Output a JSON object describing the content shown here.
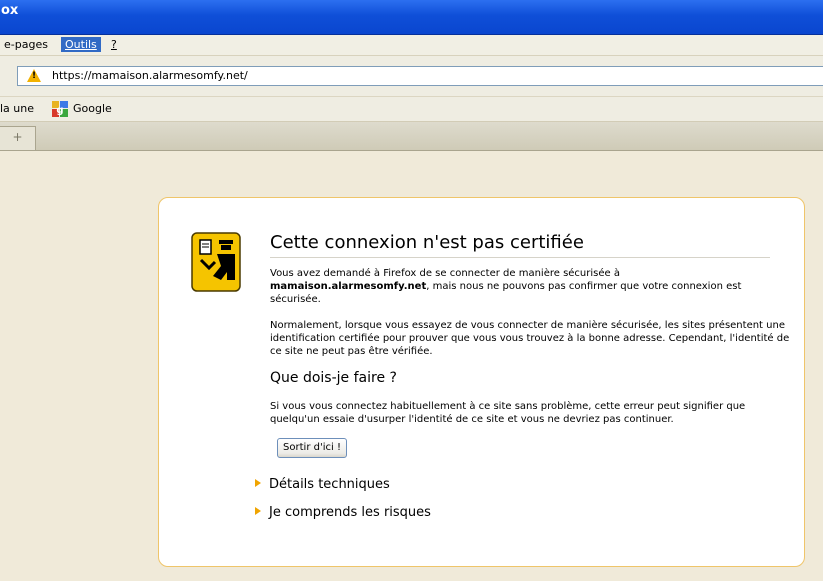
{
  "window": {
    "title": "ox"
  },
  "menubar": {
    "items": [
      {
        "label": "e-pages"
      },
      {
        "label": "Outils",
        "accelerator_char": "O"
      },
      {
        "label": "?"
      }
    ]
  },
  "navbar": {
    "url": "https://mamaison.alarmesomfy.net/"
  },
  "bookmarks": {
    "items": [
      {
        "label": "la une"
      },
      {
        "label": "Google"
      }
    ]
  },
  "tab": {
    "icon": "new-tab-icon",
    "glyph": "+"
  },
  "error_page": {
    "title": "Cette connexion n'est pas certifiée",
    "intro_prefix": "Vous avez demandé à Firefox de se connecter de manière sécurisée à",
    "intro_domain": "mamaison.alarmesomfy.net",
    "intro_suffix": ", mais nous ne pouvons pas confirmer que votre connexion est sécurisée.",
    "normal_text": "Normalement, lorsque vous essayez de vous connecter de manière sécurisée, les sites présentent une identification certifiée pour prouver que vous vous trouvez à la bonne adresse. Cependant, l'identité de ce site ne peut pas être vérifiée.",
    "what_to_do_heading": "Que dois-je faire ?",
    "what_to_do_text": "Si vous vous connectez habituellement à ce site sans problème, cette erreur peut signifier que quelqu'un essaie d'usurper l'identité de ce site et vous ne devriez pas continuer.",
    "escape_button": "Sortir d'ici !",
    "technical_details": "Détails techniques",
    "understand_risks": "Je comprends les risques"
  },
  "colors": {
    "titlebar": "#0f4fd8",
    "warning_yellow": "#f2b200",
    "expander_arrow": "#f0a400",
    "page_border": "#efc56a"
  }
}
